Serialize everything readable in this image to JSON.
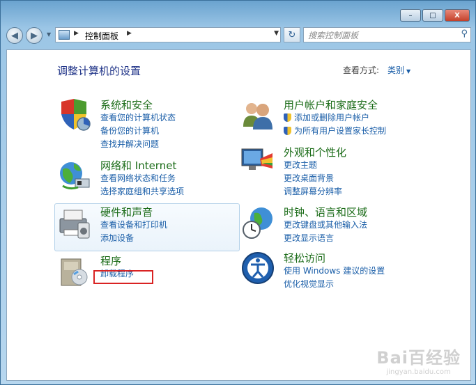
{
  "window": {
    "minimize_label": "–",
    "maximize_label": "□",
    "close_label": "X"
  },
  "navbar": {
    "address_crumb": "控制面板",
    "search_placeholder": "搜索控制面板"
  },
  "header": {
    "title": "调整计算机的设置",
    "view_by_label": "查看方式:",
    "view_by_value": "类别"
  },
  "categories": [
    {
      "title": "系统和安全",
      "links": [
        "查看您的计算机状态",
        "备份您的计算机",
        "查找并解决问题"
      ]
    },
    {
      "title": "网络和 Internet",
      "links": [
        "查看网络状态和任务",
        "选择家庭组和共享选项"
      ]
    },
    {
      "title": "硬件和声音",
      "links": [
        "查看设备和打印机",
        "添加设备"
      ]
    },
    {
      "title": "程序",
      "links": [
        "卸载程序"
      ]
    },
    {
      "title": "用户帐户和家庭安全",
      "links": [
        "添加或删除用户帐户",
        "为所有用户设置家长控制"
      ]
    },
    {
      "title": "外观和个性化",
      "links": [
        "更改主题",
        "更改桌面背景",
        "调整屏幕分辨率"
      ]
    },
    {
      "title": "时钟、语言和区域",
      "links": [
        "更改键盘或其他输入法",
        "更改显示语言"
      ]
    },
    {
      "title": "轻松访问",
      "links": [
        "使用 Windows 建议的设置",
        "优化视觉显示"
      ]
    }
  ],
  "watermark": {
    "line1": "Bai百经验",
    "line2": "jingyan.baidu.com"
  },
  "colors": {
    "category_title": "#1a6b17",
    "link": "#1a5ea8",
    "highlight_box": "#d92323"
  }
}
